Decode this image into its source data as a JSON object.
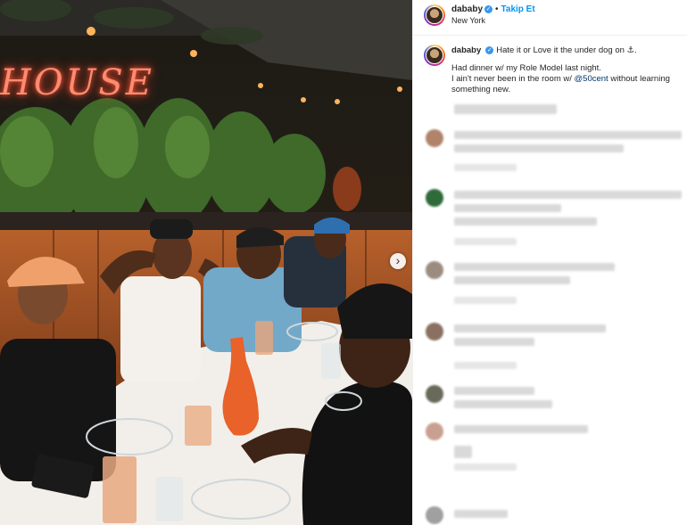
{
  "photo": {
    "neon_sign": "HOUSE",
    "next_icon": "chevron-right-icon"
  },
  "post": {
    "username": "dababy",
    "verified_icon": "verified-badge-icon",
    "separator": "•",
    "follow_label": "Takip Et",
    "location": "New York"
  },
  "caption": {
    "username": "dababy",
    "line1": "Hate it or Love it the under dog on ⚓.",
    "line2": "Had dinner w/ my Role Model last night.",
    "line3_before": "I ain't never been in the room w/ ",
    "mention": "@50cent",
    "line3_after": " without learning something new."
  },
  "colors": {
    "follow": "#0095f6",
    "mention": "#00376b",
    "neon": "#ff8a70"
  }
}
